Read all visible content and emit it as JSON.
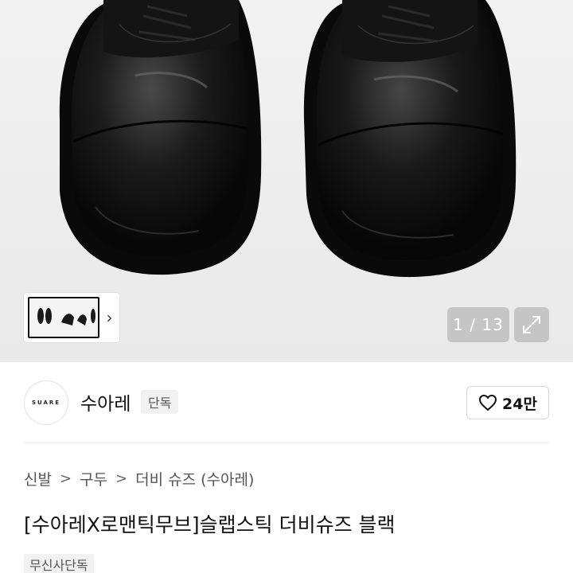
{
  "gallery": {
    "counter": "1 / 13",
    "thumbnail_arrow": "›",
    "expand_icon": "expand-icon"
  },
  "brand": {
    "logo_text": "SUARE",
    "name": "수아레",
    "badge": "단독"
  },
  "like": {
    "count": "24만",
    "icon": "heart-outline-icon"
  },
  "breadcrumb": {
    "items": [
      "신발",
      "구두",
      "더비 슈즈 (수아레)"
    ],
    "separator": ">"
  },
  "product": {
    "title": "[수아레X로맨틱무브]슬랩스틱 더비슈즈 블랙",
    "store_badge": "무신사단독"
  },
  "colors": {
    "hero_background": "#efefef",
    "overlay": "#bebebe",
    "badge_background": "#f1f1f1"
  }
}
